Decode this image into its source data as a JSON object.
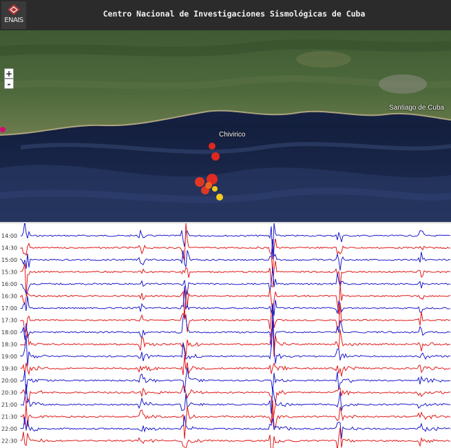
{
  "header": {
    "logo_text": "ENAIS",
    "title": "Centro Nacional de Investigaciones Sismológicas de Cuba"
  },
  "map": {
    "zoom_in": "+",
    "zoom_out": "-",
    "labels": {
      "santiago": "Santiago de Cuba",
      "chivirico": "Chivirico"
    },
    "event_colors": [
      "#ff2a1a",
      "#ff4a1c",
      "#ffd21a",
      "#e0007a"
    ]
  },
  "seismogram": {
    "time_labels": [
      "14:00",
      "14:30",
      "15:00",
      "15:30",
      "16:00",
      "16:30",
      "17:00",
      "17:30",
      "18:00",
      "18:30",
      "19:00",
      "19:30",
      "20:00",
      "20:30",
      "21:00",
      "21:30",
      "22:00",
      "22:30"
    ],
    "trace_colors": [
      "#1a1acc",
      "#e01818"
    ]
  }
}
